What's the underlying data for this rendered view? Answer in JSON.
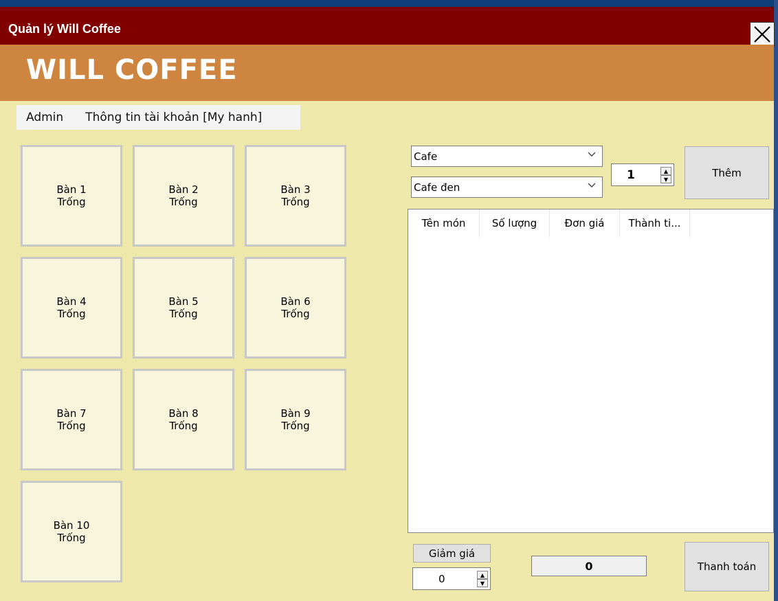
{
  "window": {
    "title": "Quản lý Will Coffee"
  },
  "banner": {
    "title": "WILL COFFEE"
  },
  "menu": {
    "items": [
      {
        "label": "Admin"
      },
      {
        "label": "Thông tin tài khoản [My hanh]"
      }
    ]
  },
  "tables": [
    {
      "name": "Bàn 1",
      "status": "Trống"
    },
    {
      "name": "Bàn 2",
      "status": "Trống"
    },
    {
      "name": "Bàn 3",
      "status": "Trống"
    },
    {
      "name": "Bàn 4",
      "status": "Trống"
    },
    {
      "name": "Bàn 5",
      "status": "Trống"
    },
    {
      "name": "Bàn 6",
      "status": "Trống"
    },
    {
      "name": "Bàn 7",
      "status": "Trống"
    },
    {
      "name": "Bàn 8",
      "status": "Trống"
    },
    {
      "name": "Bàn 9",
      "status": "Trống"
    },
    {
      "name": "Bàn 10",
      "status": "Trống"
    }
  ],
  "order": {
    "category": "Cafe",
    "food": "Cafe đen",
    "quantity": "1",
    "add_label": "Thêm",
    "columns": [
      "Tên món",
      "Số lượng",
      "Đơn giá",
      "Thành ti..."
    ],
    "discount_label": "Giảm giá",
    "discount_value": "0",
    "total": "0",
    "pay_label": "Thanh toán"
  },
  "colors": {
    "titlebar": "#800000",
    "banner": "#cd853f",
    "background": "#eee8aa"
  }
}
